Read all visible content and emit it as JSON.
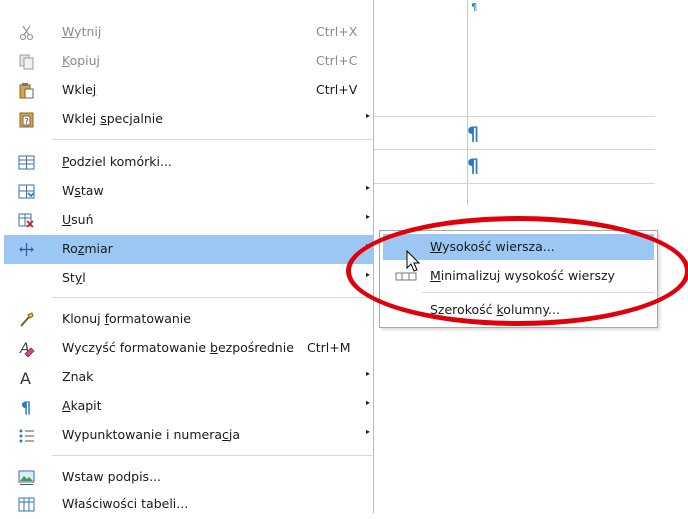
{
  "menu": {
    "items": [
      {
        "label": "Wytnij",
        "shortcut": "Ctrl+X",
        "icon": "scissors-icon",
        "disabled": true
      },
      {
        "label": "Kopiuj",
        "shortcut": "Ctrl+C",
        "icon": "copy-icon",
        "disabled": true
      },
      {
        "label": "Wklej",
        "shortcut": "Ctrl+V",
        "icon": "paste-icon"
      },
      {
        "label": "Wklej specjalnie",
        "icon": "paste-special-icon",
        "submenu": true
      },
      {
        "label": "Podziel komórki...",
        "icon": "split-cells-icon"
      },
      {
        "label": "Wstaw",
        "icon": "insert-rows-icon",
        "submenu": true
      },
      {
        "label": "Usuń",
        "icon": "delete-rows-icon",
        "submenu": true
      },
      {
        "label": "Rozmiar",
        "icon": "resize-icon",
        "submenu": true,
        "highlighted": true
      },
      {
        "label": "Styl",
        "submenu": true
      },
      {
        "label": "Klonuj formatowanie",
        "icon": "clone-formatting-icon"
      },
      {
        "label": "Wyczyść formatowanie bezpośrednie",
        "shortcut": "Ctrl+M",
        "icon": "clear-formatting-icon"
      },
      {
        "label": "Znak",
        "icon": "character-icon",
        "submenu": true
      },
      {
        "label": "Akapit",
        "icon": "paragraph-icon",
        "submenu": true
      },
      {
        "label": "Wypunktowanie i numeracja",
        "icon": "bullets-icon",
        "submenu": true
      },
      {
        "label": "Wstaw podpis...",
        "icon": "caption-icon"
      },
      {
        "label": "Właściwości tabeli...",
        "icon": "table-properties-icon"
      }
    ]
  },
  "submenu": {
    "items": [
      {
        "label": "Wysokość wiersza...",
        "highlighted": true
      },
      {
        "label": "Minimalizuj wysokość wierszy",
        "icon": "minimize-row-height-icon"
      },
      {
        "label": "Szerokość kolumny..."
      }
    ]
  },
  "colors": {
    "highlight": "#9cc7f2",
    "annotation": "#e0000a",
    "pilcrow": "#2a7bbf"
  }
}
